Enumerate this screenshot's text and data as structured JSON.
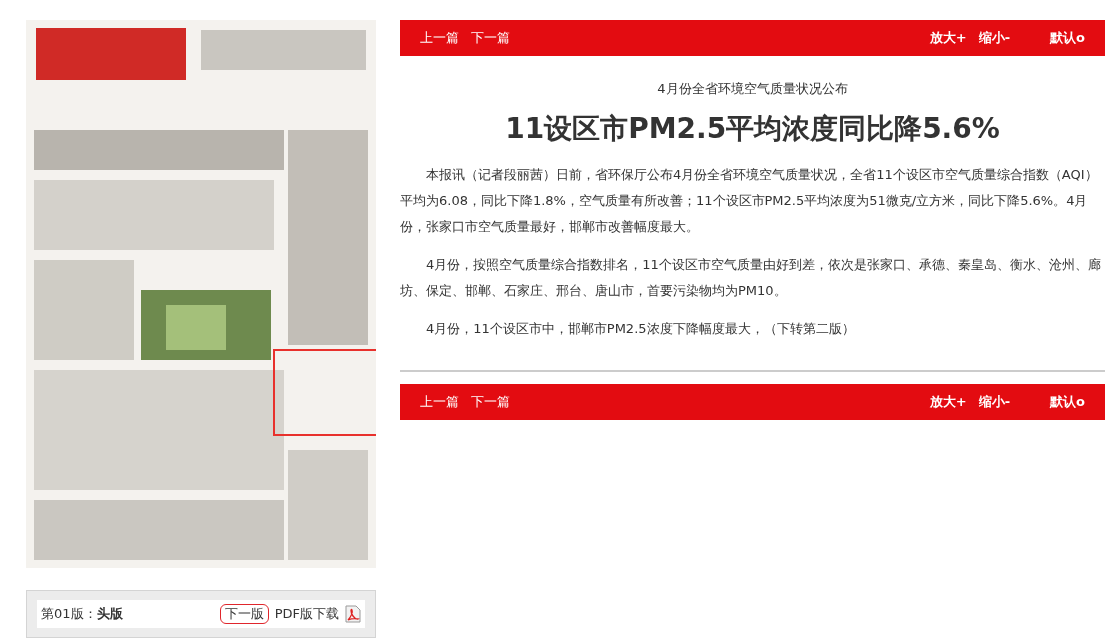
{
  "page_bar": {
    "edition": "第01版：",
    "section": "头版",
    "next_edition": "下一版",
    "pdf_download": "PDF版下载"
  },
  "toolbars": [
    {
      "prev": "上一篇",
      "next": "下一篇",
      "zoom_in": "放大+",
      "zoom_out": "缩小-",
      "reset": "默认o"
    },
    {
      "prev": "上一篇",
      "next": "下一篇",
      "zoom_in": "放大+",
      "zoom_out": "缩小-",
      "reset": "默认o"
    }
  ],
  "article": {
    "kicker": "4月份全省环境空气质量状况公布",
    "title": "11设区市PM2.5平均浓度同比降5.6%",
    "paragraphs": [
      "本报讯（记者段丽茜）日前，省环保厅公布4月份全省环境空气质量状况，全省11个设区市空气质量综合指数（AQI）平均为6.08，同比下降1.8%，空气质量有所改善；11个设区市PM2.5平均浓度为51微克/立方米，同比下降5.6%。4月份，张家口市空气质量最好，邯郸市改善幅度最大。",
      "4月份，按照空气质量综合指数排名，11个设区市空气质量由好到差，依次是张家口、承德、秦皇岛、衡水、沧州、廊坊、保定、邯郸、石家庄、邢台、唐山市，首要污染物均为PM10。",
      "4月份，11个设区市中，邯郸市PM2.5浓度下降幅度最大，（下转第二版）"
    ]
  }
}
